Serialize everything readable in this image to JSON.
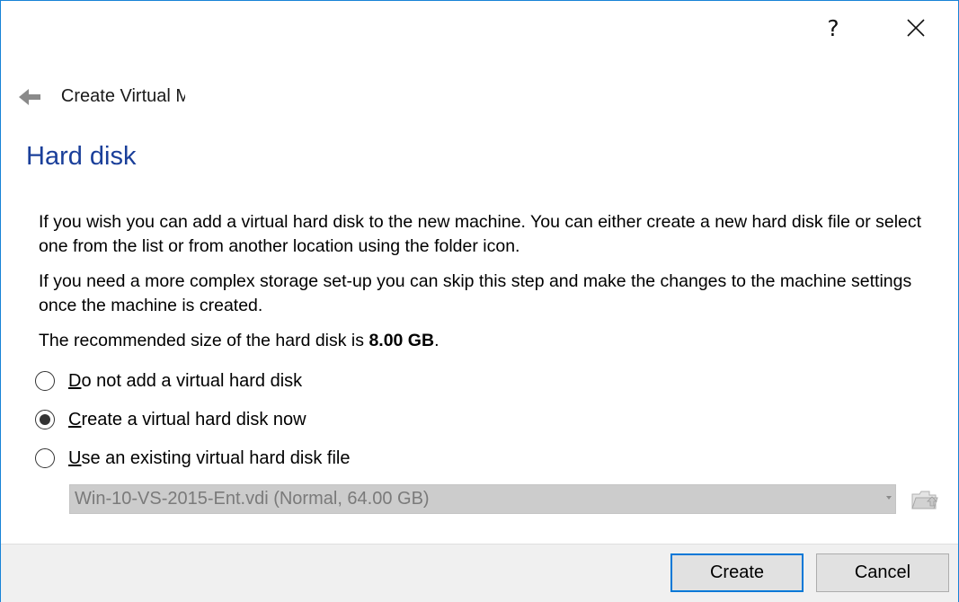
{
  "window": {
    "help_label": "?",
    "close_icon": "close-icon"
  },
  "wizard": {
    "title": "Create Virtual Machine",
    "back_icon": "back-arrow-icon"
  },
  "page": {
    "heading": "Hard disk",
    "paragraph1": "If you wish you can add a virtual hard disk to the new machine. You can either create a new hard disk file or select one from the list or from another location using the folder icon.",
    "paragraph2": "If you need a more complex storage set-up you can skip this step and make the changes to the machine settings once the machine is created.",
    "recommended_prefix": "The recommended size of the hard disk is ",
    "recommended_size": "8.00 GB",
    "recommended_suffix": "."
  },
  "options": [
    {
      "mnemonic": "D",
      "rest": "o not add a virtual hard disk",
      "selected": false
    },
    {
      "mnemonic": "C",
      "rest": "reate a virtual hard disk now",
      "selected": true
    },
    {
      "mnemonic": "U",
      "rest": "se an existing virtual hard disk file",
      "selected": false
    }
  ],
  "existing_disk": {
    "selected_value": "Win-10-VS-2015-Ent.vdi (Normal, 64.00 GB)",
    "enabled": false,
    "folder_icon": "folder-icon"
  },
  "buttons": {
    "create_label": "Create",
    "cancel_label": "Cancel"
  },
  "colors": {
    "heading": "#1a3f9a",
    "window_border": "#1883d7",
    "default_button_border": "#0078d7"
  }
}
